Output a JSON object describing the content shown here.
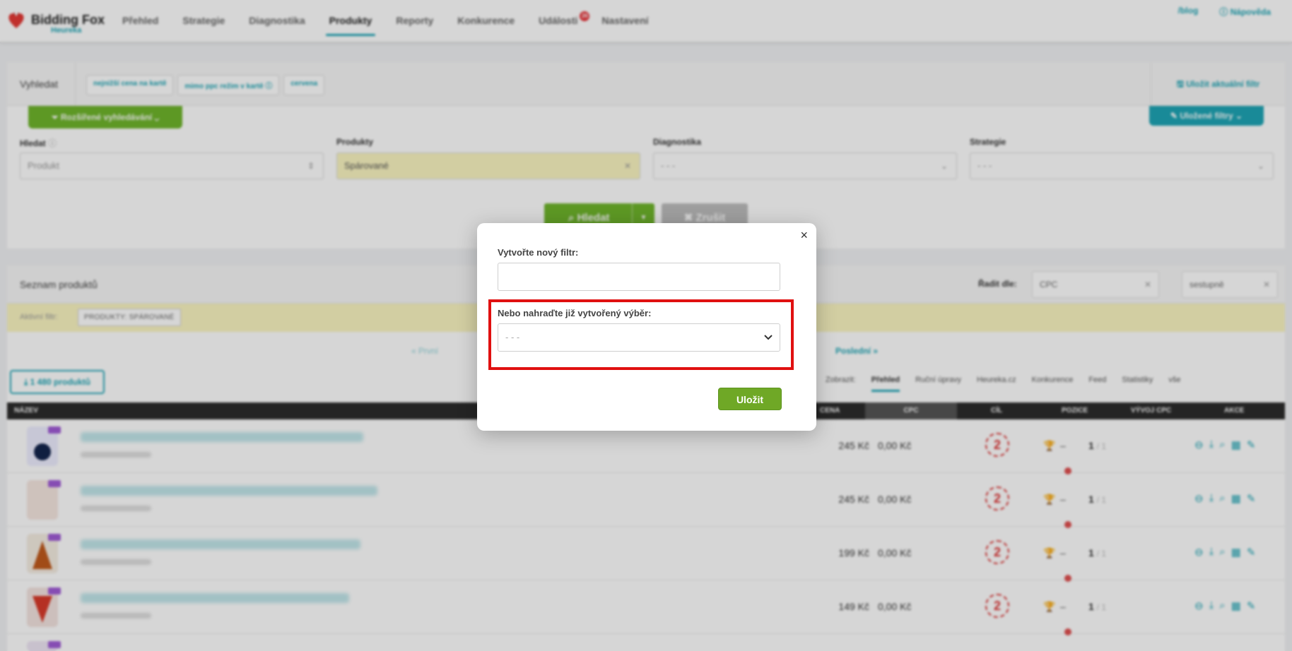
{
  "app": {
    "brand": "Bidding Fox",
    "sub_brand": "Heureka"
  },
  "nav": {
    "items": [
      {
        "label": "Přehled"
      },
      {
        "label": "Strategie"
      },
      {
        "label": "Diagnostika"
      },
      {
        "label": "Produkty"
      },
      {
        "label": "Reporty"
      },
      {
        "label": "Konkurence"
      },
      {
        "label": "Události"
      },
      {
        "label": "Nastavení"
      }
    ],
    "active_index": 3,
    "events_badge": "26",
    "blog": "/blog",
    "help": "Nápověda"
  },
  "search": {
    "title": "Vyhledat",
    "tags": [
      "nejnižší cena na kartě",
      "mimo ppc režim v kartě",
      "cervena"
    ],
    "save_current_filter": "Uložit aktuální filtr",
    "advanced_button": "Rozšířené vyhledávání",
    "saved_filters_button": "Uložené filtry",
    "fields": {
      "hledat": {
        "label": "Hledat",
        "placeholder": "Produkt"
      },
      "produkty": {
        "label": "Produkty",
        "value": "Spárované"
      },
      "diagnostika": {
        "label": "Diagnostika",
        "value": "- - -"
      },
      "strategie": {
        "label": "Strategie",
        "value": "- - -"
      }
    },
    "search_button": "Hledat",
    "cancel_button": "Zrušit"
  },
  "list": {
    "title": "Seznam produktů",
    "sort_label": "Řadit dle:",
    "sort_field": "CPC",
    "sort_order": "sestupně",
    "active_filter_label": "Aktivní filtr:",
    "active_filter_value": "PRODUKTY: SPÁROVANÉ",
    "pager_first": "« První",
    "pager_last": "Poslední »",
    "count_button": "1 480 produktů",
    "view_label": "Zobrazit:",
    "view_tabs": [
      "Přehled",
      "Ruční úpravy",
      "Heureka.cz",
      "Konkurence",
      "Feed",
      "Statistiky",
      "vše"
    ],
    "columns": {
      "name": "NÁZEV",
      "price": "CENA",
      "cpc": "CPC",
      "target": "CÍL",
      "position": "POZICE",
      "cpc_dev": "VÝVOJ CPC",
      "actions": "AKCE"
    },
    "rows": [
      {
        "price": "245 Kč",
        "cpc": "0,00 Kč",
        "target": "2",
        "position": "1",
        "position_total": "/ 1"
      },
      {
        "price": "245 Kč",
        "cpc": "0,00 Kč",
        "target": "2",
        "position": "1",
        "position_total": "/ 1"
      },
      {
        "price": "199 Kč",
        "cpc": "0,00 Kč",
        "target": "2",
        "position": "1",
        "position_total": "/ 1"
      },
      {
        "price": "149 Kč",
        "cpc": "0,00 Kč",
        "target": "2",
        "position": "1",
        "position_total": "/ 1"
      }
    ]
  },
  "modal": {
    "new_filter_label": "Vytvořte nový filtr:",
    "new_filter_value": "",
    "replace_label": "Nebo nahraďte již vytvořený výběr:",
    "replace_select_value": "- - -",
    "save_button": "Uložit"
  },
  "colors": {
    "accent": "#1ea5b5",
    "primary_green": "#6fb52c",
    "highlight_red": "#e01010"
  }
}
